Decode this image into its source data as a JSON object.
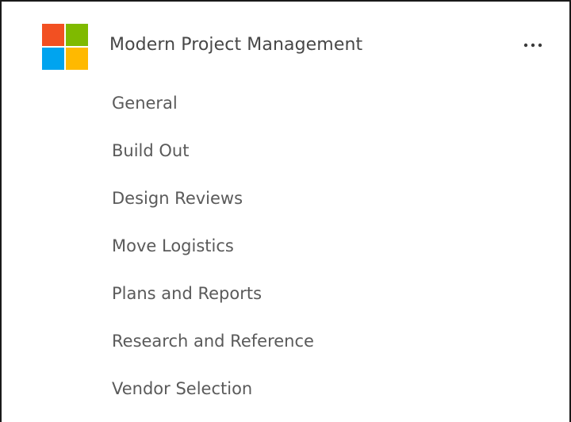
{
  "team": {
    "name": "Modern Project Management",
    "logo_icon": "microsoft-logo-icon",
    "logo_colors": [
      "#F25022",
      "#7FBA00",
      "#00A4EF",
      "#FFB900"
    ],
    "more_icon": "more-options-icon"
  },
  "channels": [
    {
      "label": "General"
    },
    {
      "label": "Build Out"
    },
    {
      "label": "Design Reviews"
    },
    {
      "label": "Move Logistics"
    },
    {
      "label": "Plans and Reports"
    },
    {
      "label": "Research and Reference"
    },
    {
      "label": "Vendor Selection"
    }
  ],
  "colors": {
    "text": "#5a5a5a",
    "title": "#474747",
    "border": "#1a1a1a"
  }
}
